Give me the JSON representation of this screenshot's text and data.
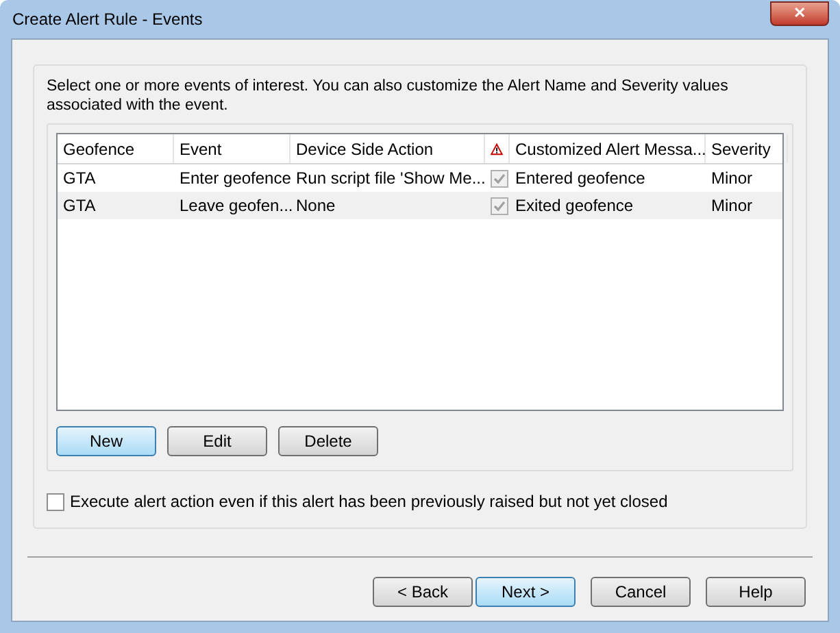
{
  "window": {
    "title": "Create Alert Rule - Events",
    "close": "✕"
  },
  "instructions": "Select one or more events of interest. You can also customize the Alert Name and Severity values associated with the event.",
  "table": {
    "columns": [
      "Geofence",
      "Event",
      "Device Side Action",
      "",
      "Customized Alert Messa...",
      "Severity"
    ],
    "rows": [
      {
        "cells": [
          "GTA",
          "Enter geofence",
          "Run script file 'Show Me...",
          "",
          "Entered geofence",
          "Minor"
        ],
        "alert_checked": true
      },
      {
        "cells": [
          "GTA",
          "Leave geofen...",
          "None",
          "",
          "Exited geofence",
          "Minor"
        ],
        "alert_checked": true
      }
    ]
  },
  "list_buttons": [
    {
      "label": "New",
      "default": true
    },
    {
      "label": "Edit",
      "default": false
    },
    {
      "label": "Delete",
      "default": false
    }
  ],
  "execute_option": {
    "label": "Execute alert action even if this alert has been previously raised but not yet closed",
    "checked": false
  },
  "footer_buttons": [
    {
      "label": "< Back",
      "default": false
    },
    {
      "label": "Next >",
      "default": true
    },
    {
      "label": "Cancel",
      "default": false
    },
    {
      "label": "Help",
      "default": false
    }
  ]
}
